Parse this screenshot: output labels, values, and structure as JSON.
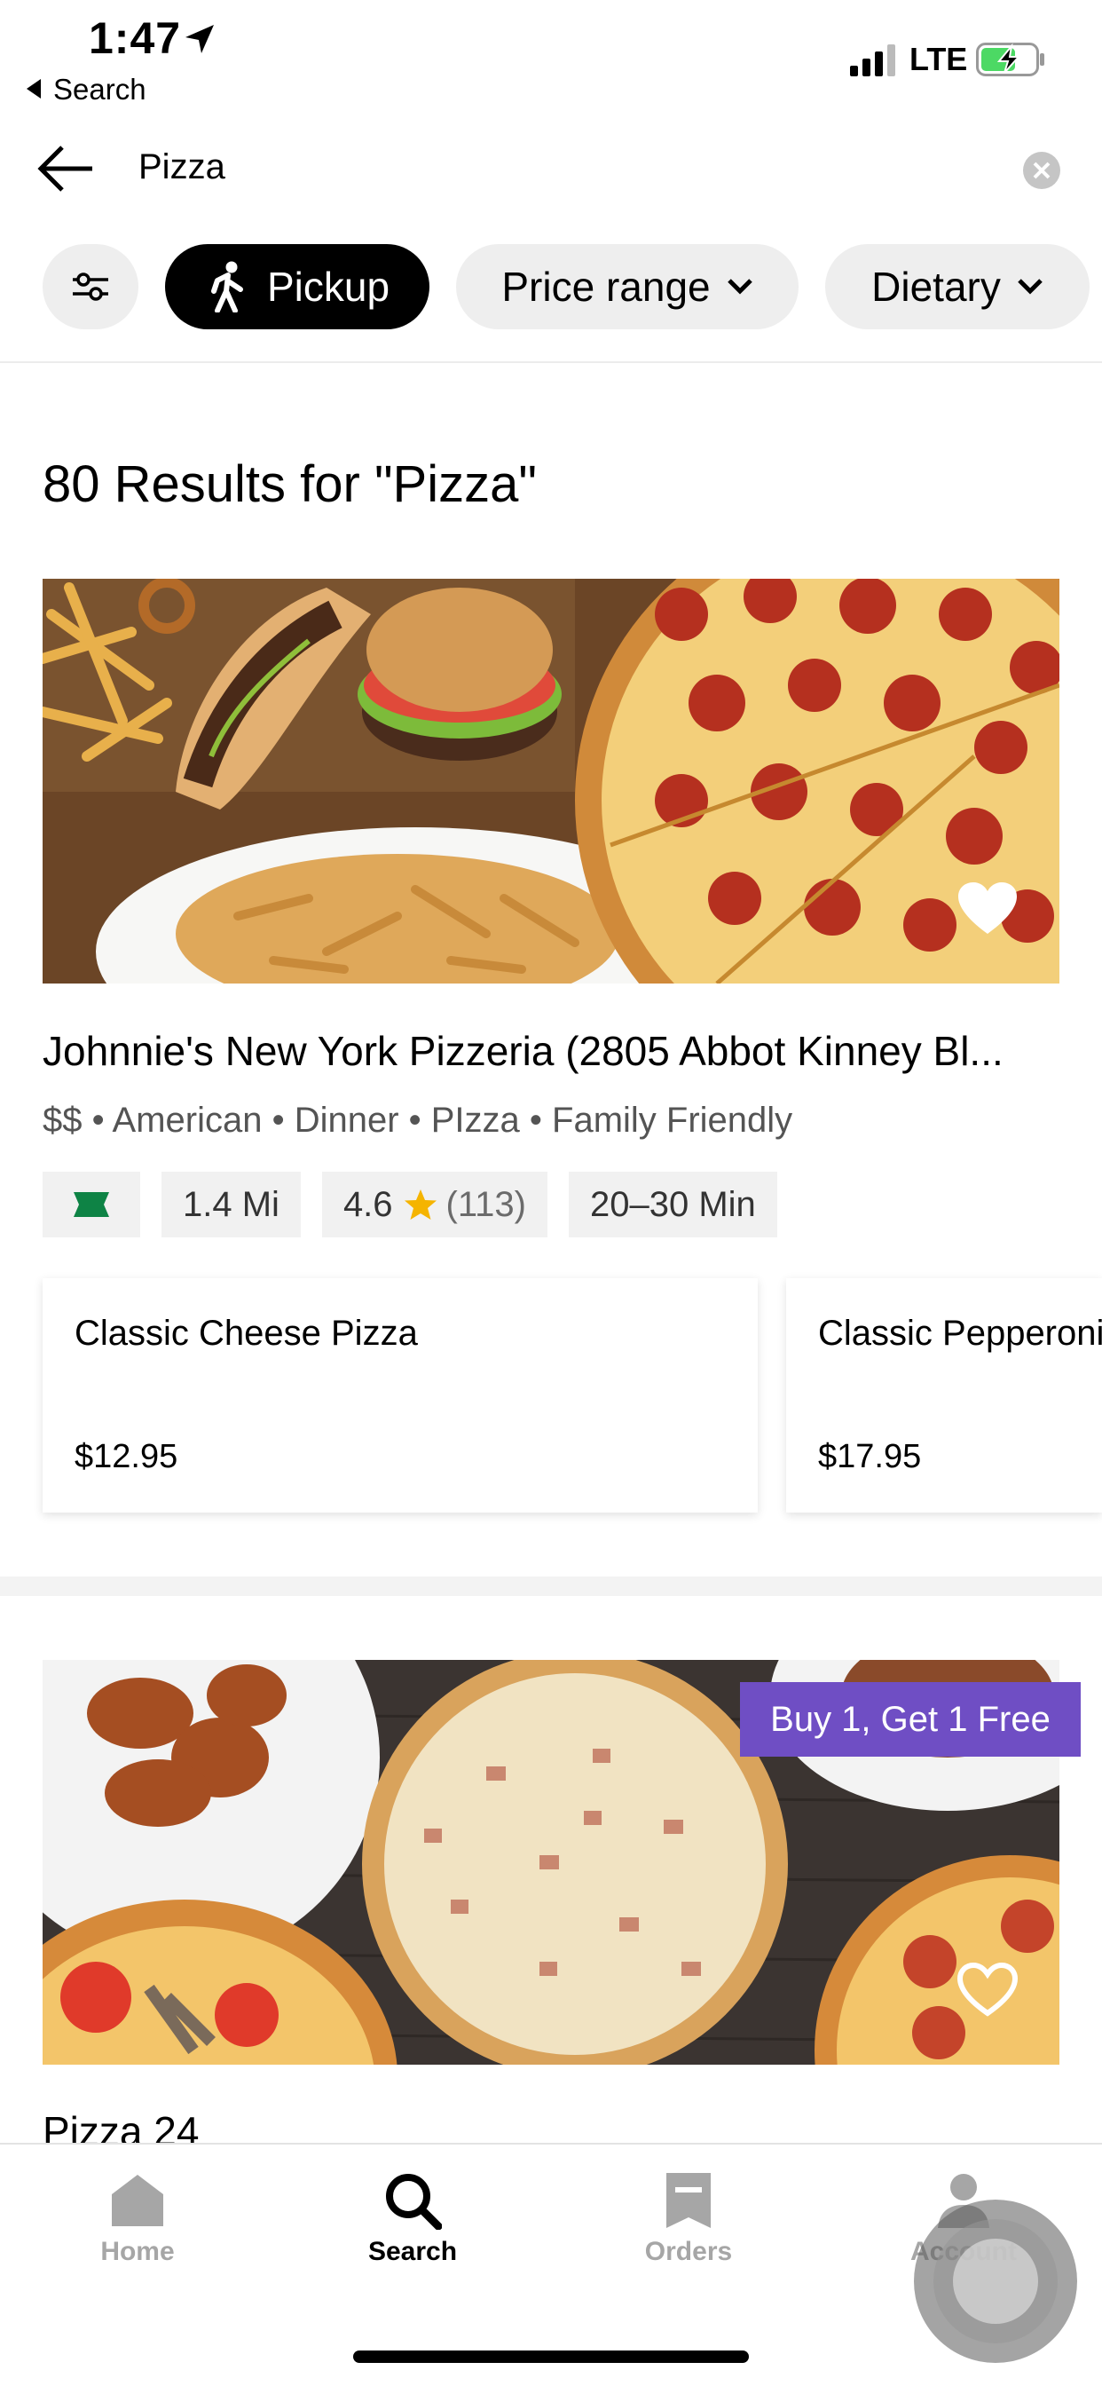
{
  "status_bar": {
    "time": "1:47",
    "back_label": "Search",
    "network": "LTE"
  },
  "search": {
    "query": "Pizza"
  },
  "filters": {
    "pickup": "Pickup",
    "price_range": "Price range",
    "dietary": "Dietary"
  },
  "results_title": "80 Results for \"Pizza\"",
  "restaurants": [
    {
      "name": "Johnnie's New York Pizzeria (2805 Abbot Kinney Bl...",
      "tags": "$$ • American • Dinner • PIzza • Family Friendly",
      "distance": "1.4 Mi",
      "rating": "4.6",
      "rating_count": "(113)",
      "eta": "20–30 Min",
      "menu": [
        {
          "name": "Classic Cheese Pizza",
          "price": "$12.95"
        },
        {
          "name": "Classic Pepperoni Pizza",
          "price": "$17.95"
        }
      ]
    },
    {
      "name": "Pizza 24",
      "promo": "Buy 1, Get 1 Free"
    }
  ],
  "tabs": [
    {
      "label": "Home"
    },
    {
      "label": "Search"
    },
    {
      "label": "Orders"
    },
    {
      "label": "Account"
    }
  ],
  "colors": {
    "promo": "#6f4ec4",
    "pickup_chip": "#000000",
    "chip": "#eeeeee",
    "rating_star": "#f5b400",
    "ticket": "#0e8345"
  }
}
